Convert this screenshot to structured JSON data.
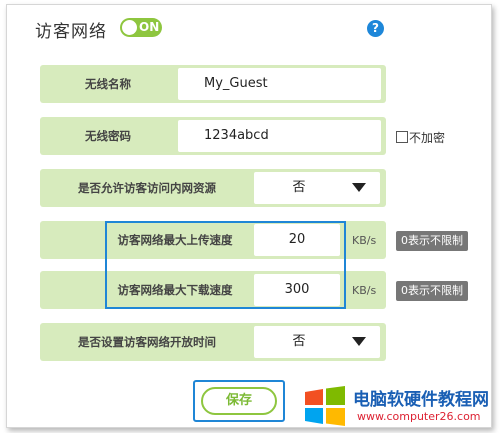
{
  "header": {
    "title": "访客网络",
    "toggle_label": "ON",
    "help_icon": "?"
  },
  "form": {
    "ssid": {
      "label": "无线名称",
      "value": "My_Guest"
    },
    "password": {
      "label": "无线密码",
      "value": "1234abcd",
      "no_encrypt_label": "不加密"
    },
    "allow_internal": {
      "label": "是否允许访客访问内网资源",
      "value": "否"
    },
    "upload": {
      "label": "访客网络最大上传速度",
      "value": "20",
      "unit": "KB/s",
      "hint": "0表示不限制"
    },
    "download": {
      "label": "访客网络最大下载速度",
      "value": "300",
      "unit": "KB/s",
      "hint": "0表示不限制"
    },
    "schedule": {
      "label": "是否设置访客网络开放时间",
      "value": "否"
    }
  },
  "actions": {
    "save_label": "保存"
  },
  "watermark": {
    "title": "电脑软硬件教程网",
    "url": "www.computer26.com"
  },
  "colors": {
    "accent_green": "#8ec63f",
    "row_bg": "#d7ebbd",
    "highlight_blue": "#1f86d6"
  }
}
